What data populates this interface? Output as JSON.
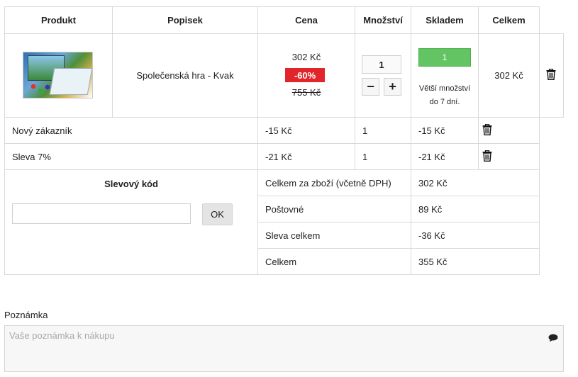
{
  "table": {
    "headers": {
      "product": "Produkt",
      "description": "Popisek",
      "price": "Cena",
      "quantity": "Množství",
      "stock": "Skladem",
      "total": "Celkem"
    },
    "item": {
      "image_icon": "product-thumbnail",
      "name": "Společenská hra - Kvak",
      "price": "302 Kč",
      "discount": "-60%",
      "old_price": "755 Kč",
      "quantity": "1",
      "minus_label": "−",
      "plus_label": "+",
      "stock_count": "1",
      "stock_note_line1": "Větší množství",
      "stock_note_line2": "do 7 dní.",
      "total": "302 Kč"
    },
    "discount_rows": [
      {
        "label": "Nový zákazník",
        "price": "-15 Kč",
        "quantity": "1",
        "total": "-15 Kč"
      },
      {
        "label": "Sleva 7%",
        "price": "-21 Kč",
        "quantity": "1",
        "total": "-21 Kč"
      }
    ]
  },
  "coupon": {
    "title": "Slevový kód",
    "input_value": "",
    "input_placeholder": "",
    "ok_label": "OK"
  },
  "summary": [
    {
      "label": "Celkem za zboží (včetně DPH)",
      "value": "302 Kč"
    },
    {
      "label": "Poštovné",
      "value": "89 Kč"
    },
    {
      "label": "Sleva celkem",
      "value": "-36 Kč"
    },
    {
      "label": "Celkem",
      "value": "355 Kč"
    }
  ],
  "note": {
    "label": "Poznámka",
    "placeholder": "Vaše poznámka k nákupu",
    "icon": "speech-bubble-icon"
  },
  "colors": {
    "discount_badge": "#e0262b",
    "stock_bar": "#62c462",
    "border": "#d9d9d9"
  }
}
